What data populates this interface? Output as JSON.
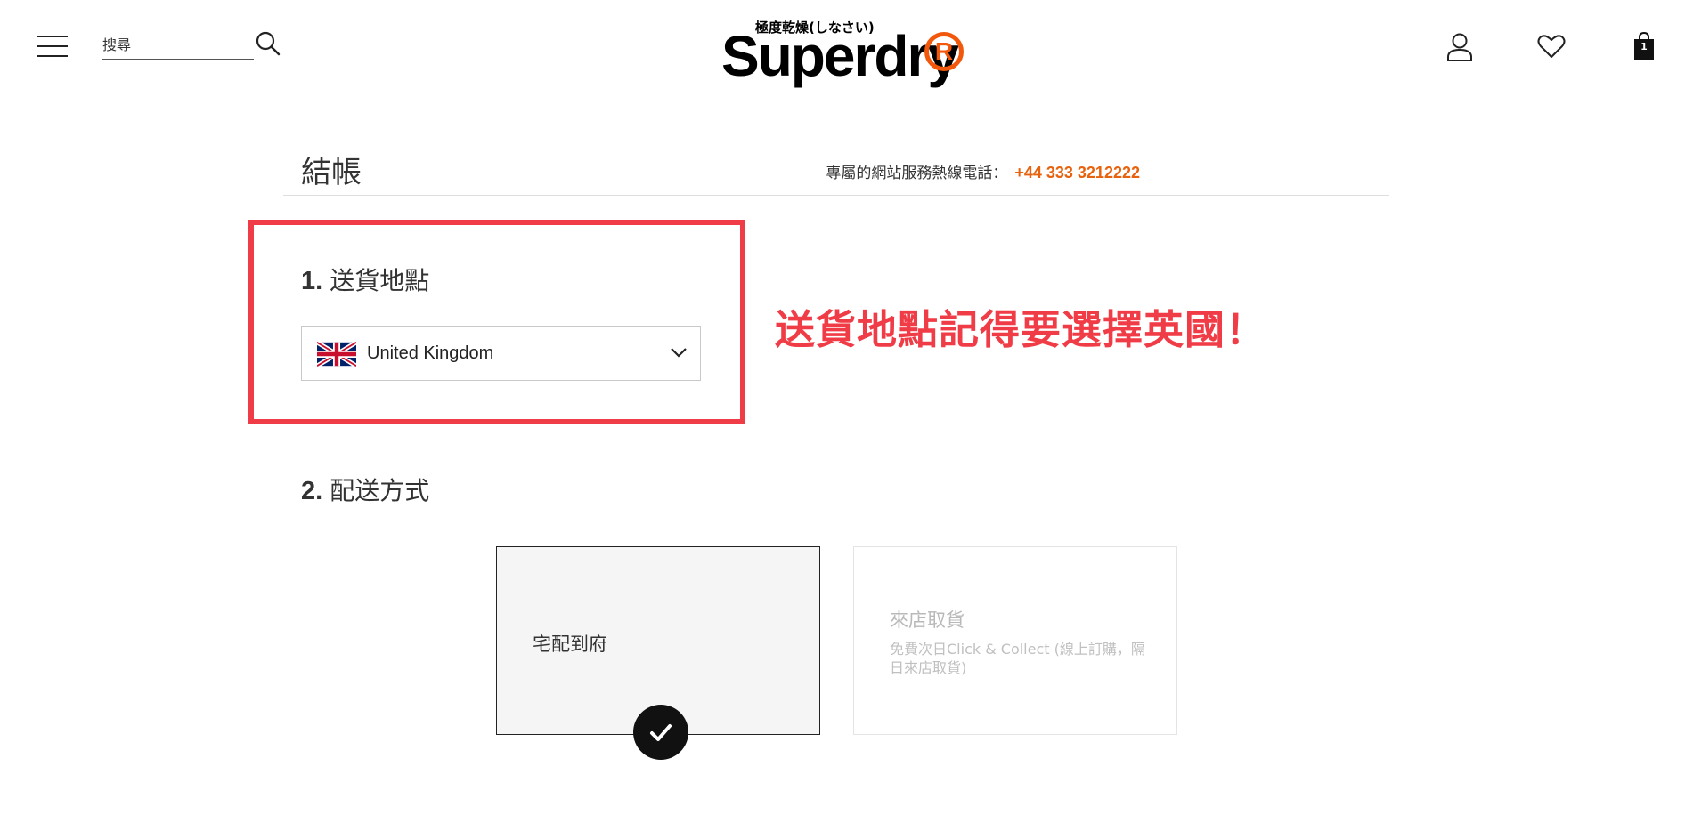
{
  "header": {
    "search_placeholder": "搜尋",
    "logo_tagline": "極度乾燥(しなさい)",
    "logo_text": "Superdry",
    "logo_reg": "R",
    "bag_count": "1"
  },
  "checkout": {
    "title": "結帳",
    "hotline_label": "專屬的網站服務熱線電話：",
    "hotline_number": "+44 333 3212222"
  },
  "section1": {
    "number": "1.",
    "heading": "送貨地點",
    "selected_country": "United Kingdom"
  },
  "annotation": "送貨地點記得要選擇英國！",
  "section2": {
    "number": "2.",
    "heading": "配送方式",
    "options": [
      {
        "label": "宅配到府",
        "selected": true
      },
      {
        "label": "來店取貨",
        "description": "免費次日Click & Collect (線上訂購，隔日來店取貨)",
        "selected": false
      }
    ]
  },
  "colors": {
    "accent_orange": "#e8620e",
    "annotation_red": "#f03c46"
  }
}
